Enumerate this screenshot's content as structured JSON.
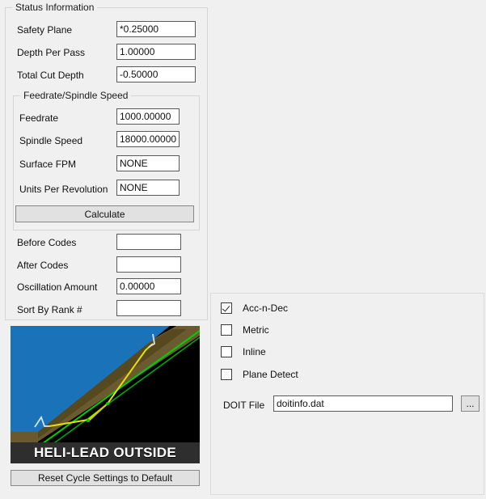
{
  "status_group": {
    "title": "Status Information",
    "fields": [
      {
        "label": "Safety Plane",
        "value": "*0.25000"
      },
      {
        "label": "Depth Per Pass",
        "value": "1.00000"
      },
      {
        "label": "Total Cut Depth",
        "value": "-0.50000"
      }
    ]
  },
  "feedrate_group": {
    "title": "Feedrate/Spindle Speed",
    "fields": [
      {
        "label": "Feedrate",
        "value": "1000.00000"
      },
      {
        "label": "Spindle Speed",
        "value": "18000.00000"
      },
      {
        "label": "Surface FPM",
        "value": "NONE"
      },
      {
        "label": "Units Per Revolution",
        "value": "NONE"
      }
    ],
    "calculate_button": "Calculate"
  },
  "code_fields": [
    {
      "label": "Before Codes",
      "value": ""
    },
    {
      "label": "After Codes",
      "value": ""
    },
    {
      "label": "Oscillation Amount",
      "value": "0.00000"
    },
    {
      "label": "Sort By Rank #",
      "value": ""
    }
  ],
  "preview": {
    "caption": "HELI-LEAD OUTSIDE",
    "colors": {
      "background": "#000000",
      "top_face": "#1a72b8",
      "side_face": "#6b5a30",
      "side_face_dark": "#4a3f21",
      "contour": "#00d000",
      "toolpath": "#e8e000",
      "lead_in": "#d8e4ec",
      "caption_bar": "#2e2e2e"
    }
  },
  "reset_button": "Reset Cycle Settings to Default",
  "options": {
    "checkboxes": [
      {
        "label": "Acc-n-Dec",
        "checked": true
      },
      {
        "label": "Metric",
        "checked": false
      },
      {
        "label": "Inline",
        "checked": false
      },
      {
        "label": "Plane Detect",
        "checked": false
      }
    ],
    "doit_file": {
      "label": "DOIT File",
      "value": "doitinfo.dat",
      "placeholder": "",
      "browse_button": "..."
    }
  }
}
